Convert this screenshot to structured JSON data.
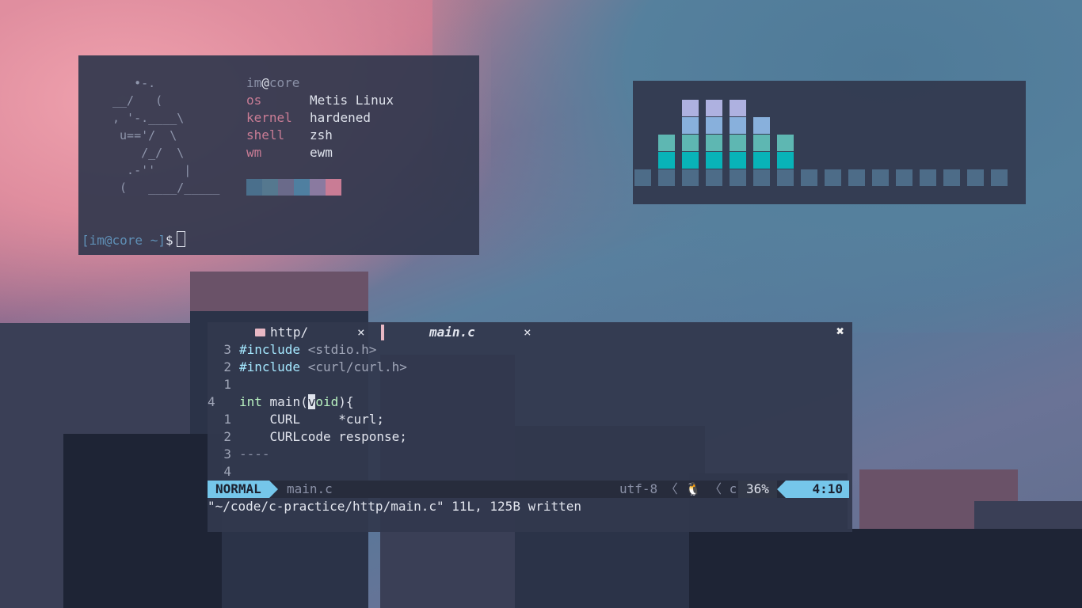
{
  "terminal": {
    "ascii_art": "   •-.\n__/   (\n, '-.____\\\n u=='/  \\\n    /_/  \\\n  .-''    |\n (   ____/_____",
    "user": "im",
    "at": "@",
    "host": "core",
    "info": [
      {
        "key": "os",
        "value": "Metis Linux"
      },
      {
        "key": "kernel",
        "value": "hardened"
      },
      {
        "key": "shell",
        "value": "zsh"
      },
      {
        "key": "wm",
        "value": "ewm"
      }
    ],
    "swatch_colors": [
      "#4a6f8c",
      "#55788f",
      "#6a6a8a",
      "#4f7fa0",
      "#8a7aa0",
      "#c97c95"
    ],
    "prompt": "[im@core ~]",
    "prompt_symbol": "$"
  },
  "visualizer": {
    "levels": [
      1,
      3,
      5,
      5,
      5,
      4,
      3,
      1,
      1,
      1,
      1,
      1,
      1,
      1,
      1,
      1
    ],
    "colors": [
      "#4d6c88",
      "#08b3b8",
      "#5eb7b2",
      "#88b0dc",
      "#aeb1e0"
    ]
  },
  "editor": {
    "tabs": [
      {
        "label": "http/",
        "close": "×"
      },
      {
        "label": "main.c",
        "close": "×"
      }
    ],
    "window_close": "✖",
    "lines": [
      {
        "num": "3",
        "parts": [
          {
            "t": "#include",
            "c": "kw"
          },
          {
            "t": " <stdio.h>",
            "c": "inc"
          }
        ]
      },
      {
        "num": "2",
        "parts": [
          {
            "t": "#include",
            "c": "kw"
          },
          {
            "t": " <curl/curl.h>",
            "c": "inc"
          }
        ]
      },
      {
        "num": "1",
        "parts": []
      },
      {
        "num": "4",
        "parts": [
          {
            "t": "int",
            "c": "ty"
          },
          {
            "t": " main(",
            "c": ""
          },
          {
            "t": "v",
            "c": "hl"
          },
          {
            "t": "oid",
            "c": "ty"
          },
          {
            "t": "){",
            "c": ""
          }
        ]
      },
      {
        "num": "1",
        "parts": [
          {
            "t": "    CURL     *curl;",
            "c": ""
          }
        ]
      },
      {
        "num": "2",
        "parts": [
          {
            "t": "    CURLcode response;",
            "c": ""
          }
        ]
      },
      {
        "num": "3",
        "parts": [
          {
            "t": "----",
            "c": "dash"
          }
        ]
      },
      {
        "num": "4",
        "parts": []
      }
    ],
    "status": {
      "mode": "NORMAL",
      "file": "main.c",
      "encoding": "utf-8 〈 🐧 〈 c",
      "percent": "36%",
      "position": "4:10"
    },
    "message": "\"~/code/c-practice/http/main.c\" 11L, 125B written"
  }
}
